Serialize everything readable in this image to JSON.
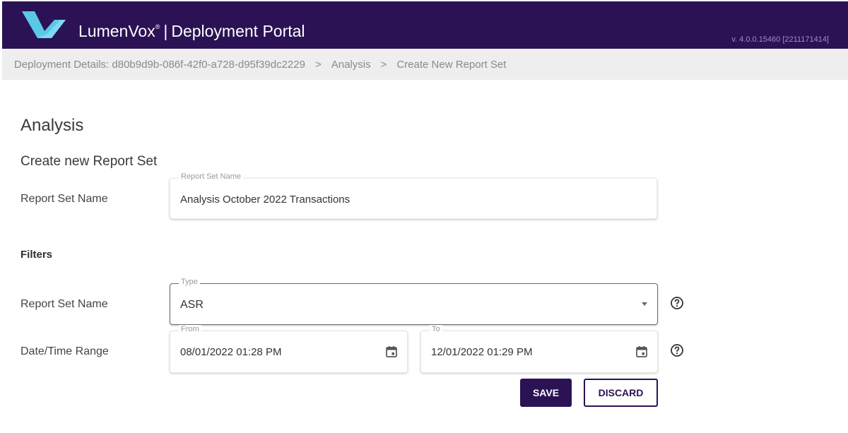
{
  "header": {
    "brand_name": "LumenVox",
    "trademark": "®",
    "separator": "|",
    "portal_title": "Deployment Portal",
    "version": "v. 4.0.0.15460 [2211171414]"
  },
  "breadcrumb": {
    "items": [
      "Deployment Details: d80b9d9b-086f-42f0-a728-d95f39dc2229",
      "Analysis",
      "Create New Report Set"
    ],
    "separator": ">"
  },
  "main": {
    "page_title": "Analysis",
    "section_title": "Create new Report Set",
    "report_set_name": {
      "label": "Report Set Name",
      "legend": "Report Set Name",
      "value": "Analysis October 2022 Transactions"
    },
    "filters": {
      "title": "Filters",
      "type": {
        "label": "Report Set Name",
        "legend": "Type",
        "value": "ASR"
      },
      "date_range": {
        "label": "Date/Time Range",
        "from_legend": "From",
        "from_value": "08/01/2022 01:28 PM",
        "to_legend": "To",
        "to_value": "12/01/2022 01:29 PM"
      }
    },
    "actions": {
      "save_label": "SAVE",
      "discard_label": "DISCARD"
    }
  },
  "icons": {
    "logo": "lumenvox-logo",
    "calendar": "calendar-icon",
    "help": "help-circle-icon",
    "dropdown": "chevron-down-icon"
  },
  "colors": {
    "brand_purple": "#2b1254",
    "logo_cyan": "#5bc8e8",
    "breadcrumb_bg": "#eeeeee"
  }
}
